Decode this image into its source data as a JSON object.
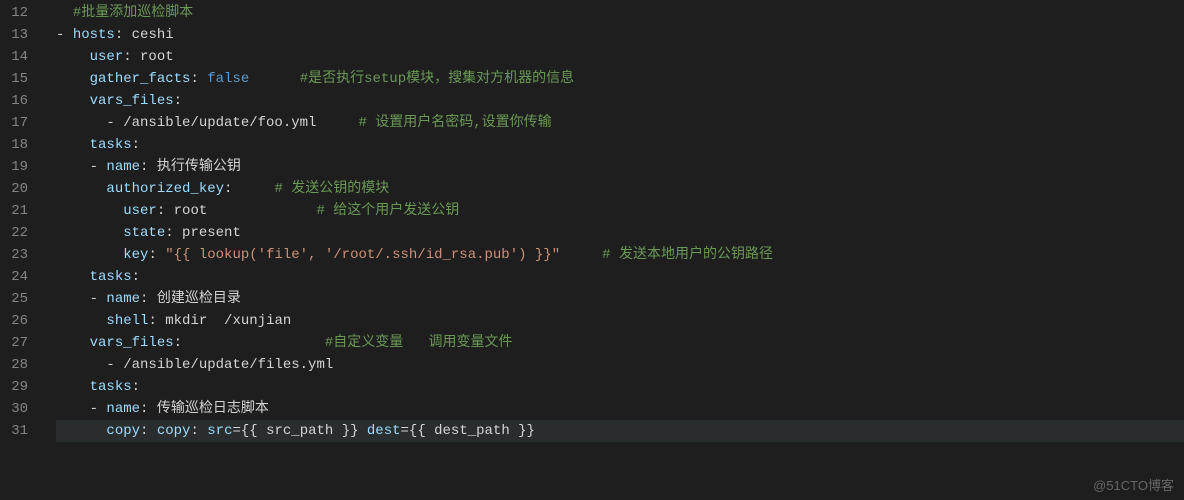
{
  "watermark": "@51CTO博客",
  "gutter": [
    "12",
    "13",
    "14",
    "15",
    "16",
    "17",
    "18",
    "19",
    "20",
    "21",
    "22",
    "23",
    "24",
    "25",
    "26",
    "27",
    "28",
    "29",
    "30",
    "31"
  ],
  "lines": [
    {
      "hl": false,
      "tokens": [
        {
          "cls": "tok-plain",
          "t": "  "
        },
        {
          "cls": "tok-cmt",
          "t": "#批量添加巡检脚本"
        }
      ]
    },
    {
      "hl": false,
      "tokens": [
        {
          "cls": "tok-plain",
          "t": "- "
        },
        {
          "cls": "tok-key",
          "t": "hosts"
        },
        {
          "cls": "tok-punct",
          "t": ": "
        },
        {
          "cls": "tok-plain",
          "t": "ceshi"
        }
      ]
    },
    {
      "hl": false,
      "tokens": [
        {
          "cls": "tok-plain",
          "t": "    "
        },
        {
          "cls": "tok-key",
          "t": "user"
        },
        {
          "cls": "tok-punct",
          "t": ": "
        },
        {
          "cls": "tok-plain",
          "t": "root"
        }
      ]
    },
    {
      "hl": false,
      "tokens": [
        {
          "cls": "tok-plain",
          "t": "    "
        },
        {
          "cls": "tok-key",
          "t": "gather_facts"
        },
        {
          "cls": "tok-punct",
          "t": ": "
        },
        {
          "cls": "tok-bool",
          "t": "false"
        },
        {
          "cls": "tok-plain",
          "t": "      "
        },
        {
          "cls": "tok-cmt",
          "t": "#是否执行setup模块，搜集对方机器的信息"
        }
      ]
    },
    {
      "hl": false,
      "tokens": [
        {
          "cls": "tok-plain",
          "t": "    "
        },
        {
          "cls": "tok-key",
          "t": "vars_files"
        },
        {
          "cls": "tok-punct",
          "t": ":"
        }
      ]
    },
    {
      "hl": false,
      "tokens": [
        {
          "cls": "tok-plain",
          "t": "      - /ansible/update/foo.yml     "
        },
        {
          "cls": "tok-cmt",
          "t": "# 设置用户名密码,设置你传输"
        }
      ]
    },
    {
      "hl": false,
      "tokens": [
        {
          "cls": "tok-plain",
          "t": "    "
        },
        {
          "cls": "tok-key",
          "t": "tasks"
        },
        {
          "cls": "tok-punct",
          "t": ":"
        }
      ]
    },
    {
      "hl": false,
      "tokens": [
        {
          "cls": "tok-plain",
          "t": "    - "
        },
        {
          "cls": "tok-key",
          "t": "name"
        },
        {
          "cls": "tok-punct",
          "t": ": "
        },
        {
          "cls": "tok-plain",
          "t": "执行传输公钥"
        }
      ]
    },
    {
      "hl": false,
      "tokens": [
        {
          "cls": "tok-plain",
          "t": "      "
        },
        {
          "cls": "tok-key",
          "t": "authorized_key"
        },
        {
          "cls": "tok-punct",
          "t": ":"
        },
        {
          "cls": "tok-plain",
          "t": "     "
        },
        {
          "cls": "tok-cmt",
          "t": "# 发送公钥的模块"
        }
      ]
    },
    {
      "hl": false,
      "tokens": [
        {
          "cls": "tok-plain",
          "t": "        "
        },
        {
          "cls": "tok-key",
          "t": "user"
        },
        {
          "cls": "tok-punct",
          "t": ": "
        },
        {
          "cls": "tok-plain",
          "t": "root             "
        },
        {
          "cls": "tok-cmt",
          "t": "# 给这个用户发送公钥"
        }
      ]
    },
    {
      "hl": false,
      "tokens": [
        {
          "cls": "tok-plain",
          "t": "        "
        },
        {
          "cls": "tok-key",
          "t": "state"
        },
        {
          "cls": "tok-punct",
          "t": ": "
        },
        {
          "cls": "tok-plain",
          "t": "present"
        }
      ]
    },
    {
      "hl": false,
      "tokens": [
        {
          "cls": "tok-plain",
          "t": "        "
        },
        {
          "cls": "tok-key",
          "t": "key"
        },
        {
          "cls": "tok-punct",
          "t": ": "
        },
        {
          "cls": "tok-str",
          "t": "\"{{ lookup('file', '/root/.ssh/id_rsa.pub') }}\""
        },
        {
          "cls": "tok-plain",
          "t": "     "
        },
        {
          "cls": "tok-cmt",
          "t": "# 发送本地用户的公钥路径"
        }
      ]
    },
    {
      "hl": false,
      "tokens": [
        {
          "cls": "tok-plain",
          "t": "    "
        },
        {
          "cls": "tok-key",
          "t": "tasks"
        },
        {
          "cls": "tok-punct",
          "t": ":"
        }
      ]
    },
    {
      "hl": false,
      "tokens": [
        {
          "cls": "tok-plain",
          "t": "    - "
        },
        {
          "cls": "tok-key",
          "t": "name"
        },
        {
          "cls": "tok-punct",
          "t": ": "
        },
        {
          "cls": "tok-plain",
          "t": "创建巡检目录"
        }
      ]
    },
    {
      "hl": false,
      "tokens": [
        {
          "cls": "tok-plain",
          "t": "      "
        },
        {
          "cls": "tok-key",
          "t": "shell"
        },
        {
          "cls": "tok-punct",
          "t": ": "
        },
        {
          "cls": "tok-plain",
          "t": "mkdir  /xunjian"
        }
      ]
    },
    {
      "hl": false,
      "tokens": [
        {
          "cls": "tok-plain",
          "t": "    "
        },
        {
          "cls": "tok-key",
          "t": "vars_files"
        },
        {
          "cls": "tok-punct",
          "t": ":"
        },
        {
          "cls": "tok-plain",
          "t": "                 "
        },
        {
          "cls": "tok-cmt",
          "t": "#自定义变量   调用变量文件"
        }
      ]
    },
    {
      "hl": false,
      "tokens": [
        {
          "cls": "tok-plain",
          "t": "      - /ansible/update/files.yml"
        }
      ]
    },
    {
      "hl": false,
      "tokens": [
        {
          "cls": "tok-plain",
          "t": "    "
        },
        {
          "cls": "tok-key",
          "t": "tasks"
        },
        {
          "cls": "tok-punct",
          "t": ":"
        }
      ]
    },
    {
      "hl": false,
      "tokens": [
        {
          "cls": "tok-plain",
          "t": "    - "
        },
        {
          "cls": "tok-key",
          "t": "name"
        },
        {
          "cls": "tok-punct",
          "t": ": "
        },
        {
          "cls": "tok-plain",
          "t": "传输巡检日志脚本"
        }
      ]
    },
    {
      "hl": true,
      "tokens": [
        {
          "cls": "tok-plain",
          "t": "      "
        },
        {
          "cls": "tok-key",
          "t": "copy"
        },
        {
          "cls": "tok-punct",
          "t": ": "
        },
        {
          "cls": "tok-key",
          "t": "copy"
        },
        {
          "cls": "tok-punct",
          "t": ": "
        },
        {
          "cls": "tok-key",
          "t": "src"
        },
        {
          "cls": "tok-plain",
          "t": "={{ src_path }} "
        },
        {
          "cls": "tok-key",
          "t": "dest"
        },
        {
          "cls": "tok-plain",
          "t": "={{ dest_path }}"
        }
      ]
    }
  ]
}
